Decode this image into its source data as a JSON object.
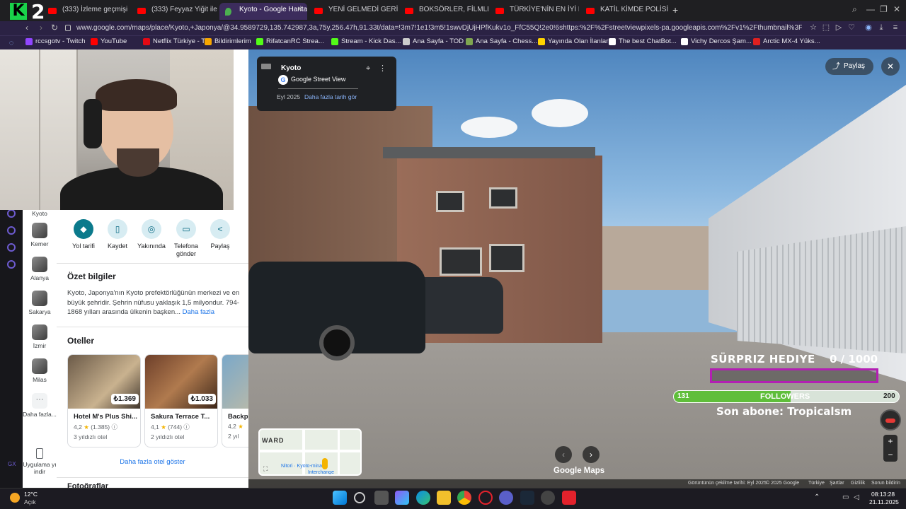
{
  "browser": {
    "tabs": [
      {
        "title": "(333) İzleme geçmişi - Yo"
      },
      {
        "title": "(333) Feyyaz Yiğit ile O M"
      },
      {
        "title": "Kyoto - Google Haritalar"
      },
      {
        "title": "YENİ GELMEDİ GERİ GEL"
      },
      {
        "title": "BOKSÖRLER, FİLMLERDE"
      },
      {
        "title": "TÜRKİYE'NİN EN İYİ PİZZ"
      },
      {
        "title": "KATİL KİMDE POLİSİ TRO"
      }
    ],
    "url": "www.google.com/maps/place/Kyoto,+Japonya/@34.9589729,135.742987,3a,75y,256.47h,91.33t/data=!3m7!1e1!3m5!1swvDjUjHPfKukv1o_FfC55Q!2e0!6shttps:%2F%2Fstreetviewpixels-pa.googleapis.com%2Fv1%2Fthumbnail%3Fcb_client%3Dmaps_",
    "bookmarks": [
      {
        "label": "rccsgotv - Twitch",
        "color": "#9146ff"
      },
      {
        "label": "YouTube",
        "color": "#ff0000"
      },
      {
        "label": "Netflix Türkiye - T...",
        "color": "#e50914"
      },
      {
        "label": "Bildirimlerim",
        "color": "#f7a600"
      },
      {
        "label": "RifatcanRC Strea...",
        "color": "#53fc18"
      },
      {
        "label": "Stream - Kick Das...",
        "color": "#53fc18"
      },
      {
        "label": "Ana Sayfa - TOD",
        "color": "#cccccc"
      },
      {
        "label": "Ana Sayfa - Chess...",
        "color": "#7fa650"
      },
      {
        "label": "Yayında Olan İlanlar",
        "color": "#ffd400"
      },
      {
        "label": "The best ChatBot...",
        "color": "#ffffff"
      },
      {
        "label": "Vichy Dercos Şam...",
        "color": "#ffffff"
      },
      {
        "label": "Arctic MX-4 Yüks...",
        "color": "#e02020"
      }
    ]
  },
  "saved_places": [
    {
      "label": "Kemer"
    },
    {
      "label": "Alanya"
    },
    {
      "label": "Sakarya"
    },
    {
      "label": "İzmir"
    },
    {
      "label": "Milas"
    },
    {
      "label": "Daha fazla..."
    },
    {
      "label": "Uygulama yı indir"
    }
  ],
  "place_panel": {
    "partial_name": "Kyoto",
    "actions": [
      {
        "label": "Yol tarifi",
        "icon": "directions-icon"
      },
      {
        "label": "Kaydet",
        "icon": "bookmark-icon"
      },
      {
        "label": "Yakınında",
        "icon": "nearby-icon"
      },
      {
        "label": "Telefona gönder",
        "icon": "phone-icon"
      },
      {
        "label": "Paylaş",
        "icon": "share-icon"
      }
    ],
    "summary_title": "Özet bilgiler",
    "summary_text": "Kyoto, Japonya'nın Kyoto prefektörlüğünün merkezi ve en büyük şehridir. Şehrin nüfusu yaklaşık 1,5 milyondur. 794-1868 yılları arasında ülkenin başken...",
    "summary_more": "Daha fazla",
    "hotels_title": "Oteller",
    "hotels": [
      {
        "name": "Hotel M's Plus Shi...",
        "price": "₺1.369",
        "rating": "4,2",
        "reviews": "(1.385)",
        "class": "3 yıldızlı otel"
      },
      {
        "name": "Sakura Terrace T...",
        "price": "₺1.033",
        "rating": "4,1",
        "reviews": "(744)",
        "class": "2 yıldızlı otel"
      },
      {
        "name": "Backp",
        "price": "",
        "rating": "4,2",
        "reviews": "",
        "class": "2 yıl"
      }
    ],
    "more_hotels": "Daha fazla otel göster",
    "next_heading": "Fotoğraflar"
  },
  "street_view": {
    "card_title": "Kyoto",
    "card_subtitle": "Google Street View",
    "date": "Eyl 2025",
    "more_dates": "Daha fazla tarih gör",
    "share": "Paylaş",
    "brand": "Google Maps",
    "attribution": [
      "Görüntünün çekilme tarihi: Eyl 2025",
      "© 2025 Google",
      "Türkiye",
      "Şartlar",
      "Gizlilik",
      "Sorun bildirin"
    ]
  },
  "minimap": {
    "ward": "WARD",
    "poi1": "Nitori · Kyoto-minami",
    "poi2": "Interchange"
  },
  "overlay": {
    "gift_title": "SÜRPRIZ HEDIYE",
    "gift_count": "0  / 1000",
    "gift_progress": 0,
    "followers_start": "131",
    "followers_label": "FOLLOWERS",
    "followers_end": "200",
    "followers_progress": 0.52,
    "last_sub": "Son abone: Tropicalsm"
  },
  "taskbar": {
    "temp": "12°C",
    "weather": "Açık",
    "time": "08:13:28",
    "date": "21.11.2025"
  }
}
